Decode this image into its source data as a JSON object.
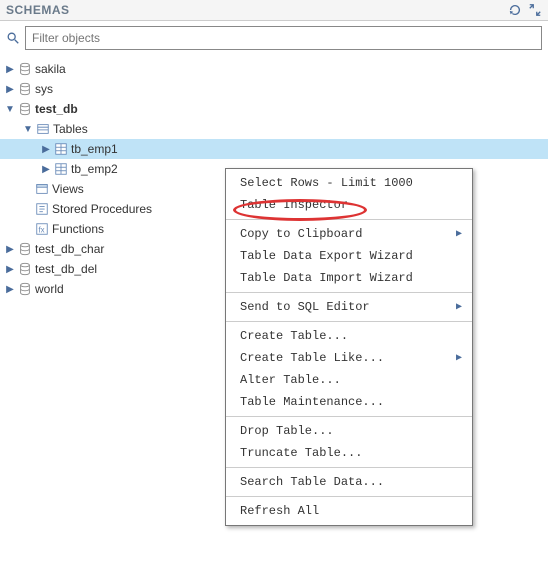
{
  "header": {
    "title": "SCHEMAS"
  },
  "search": {
    "placeholder": "Filter objects"
  },
  "tree": {
    "sakila": "sakila",
    "sys": "sys",
    "test_db": "test_db",
    "tables": "Tables",
    "tb_emp1": "tb_emp1",
    "tb_emp2": "tb_emp2",
    "views": "Views",
    "stored_procedures": "Stored Procedures",
    "functions": "Functions",
    "test_db_char": "test_db_char",
    "test_db_del": "test_db_del",
    "world": "world"
  },
  "menu": {
    "select_rows": "Select Rows - Limit 1000",
    "table_inspector": "Table Inspector",
    "copy_clipboard": "Copy to Clipboard",
    "export_wizard": "Table Data Export Wizard",
    "import_wizard": "Table Data Import Wizard",
    "send_sql": "Send to SQL Editor",
    "create_table": "Create Table...",
    "create_like": "Create Table Like...",
    "alter_table": "Alter Table...",
    "maintenance": "Table Maintenance...",
    "drop_table": "Drop Table...",
    "truncate": "Truncate Table...",
    "search_data": "Search Table Data...",
    "refresh": "Refresh All"
  }
}
